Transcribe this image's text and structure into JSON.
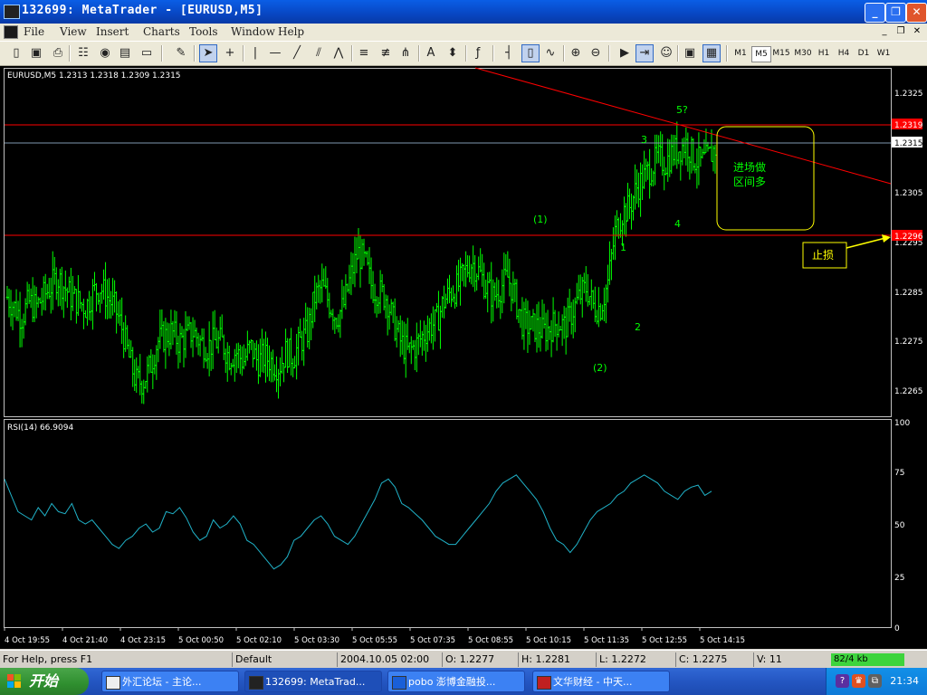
{
  "window": {
    "title": "132699: MetaTrader - [EURUSD,M5]",
    "controls": [
      "_",
      "❐",
      "✕"
    ]
  },
  "menu": {
    "items": [
      "File",
      "View",
      "Insert",
      "Charts",
      "Tools",
      "Window",
      "Help"
    ],
    "mdi_controls": [
      "_",
      "❐",
      "✕"
    ]
  },
  "toolbar": {
    "timeframes": [
      "M1",
      "M5",
      "M15",
      "M30",
      "H1",
      "H4",
      "D1",
      "W1"
    ],
    "selected_timeframe": "M5"
  },
  "chart": {
    "header": "EURUSD,M5  1.2313 1.2318 1.2309 1.2315",
    "price_ticks": [
      "1.2325",
      "1.2315",
      "1.2305",
      "1.2295",
      "1.2285",
      "1.2275",
      "1.2265"
    ],
    "levels": {
      "top_red": "1.2319",
      "bid": "1.2315",
      "stop_red": "1.2296"
    },
    "time_labels": [
      "4 Oct 19:55",
      "4 Oct 21:40",
      "4 Oct 23:15",
      "5 Oct 00:50",
      "5 Oct 02:10",
      "5 Oct 03:30",
      "5 Oct 05:55",
      "5 Oct 07:35",
      "5 Oct 08:55",
      "5 Oct 10:15",
      "5 Oct 11:35",
      "5 Oct 12:55",
      "5 Oct 14:15"
    ],
    "wave_labels": [
      "(1)",
      "(2)",
      "1",
      "2",
      "3",
      "4",
      "5?"
    ],
    "annotation_entry": "进场做\n区间多",
    "annotation_stop": "止损",
    "rsi_header": "RSI(14) 66.9094",
    "rsi_ticks": [
      "100",
      "75",
      "50",
      "25",
      "0"
    ],
    "colors": {
      "bar": "#00ff00",
      "rsi": "#20b2c8",
      "red_line": "#ff0000",
      "annotation": "#ffff00",
      "text_green": "#00ff00"
    }
  },
  "chart_data": {
    "type": "ohlc",
    "symbol": "EURUSD",
    "timeframe": "M5",
    "ylim": [
      1.2261,
      1.2331
    ],
    "rsi_ylim": [
      0,
      100
    ],
    "close_path": [
      1.2285,
      1.2283,
      1.2281,
      1.2284,
      1.2283,
      1.2285,
      1.2287,
      1.2289,
      1.2287,
      1.2285,
      1.2284,
      1.2283,
      1.2286,
      1.2287,
      1.2285,
      1.2283,
      1.2279,
      1.2273,
      1.2268,
      1.2268,
      1.2271,
      1.2276,
      1.2277,
      1.2278,
      1.2276,
      1.2277,
      1.2278,
      1.2276,
      1.2275,
      1.2276,
      1.2276,
      1.2273,
      1.2274,
      1.2272,
      1.2275,
      1.2272,
      1.2273,
      1.2272,
      1.2271,
      1.2274,
      1.2273,
      1.2276,
      1.2278,
      1.2285,
      1.2287,
      1.2284,
      1.2281,
      1.2283,
      1.2289,
      1.2294,
      1.2292,
      1.2287,
      1.2286,
      1.2285,
      1.228,
      1.2276,
      1.2274,
      1.2275,
      1.2277,
      1.2279,
      1.228,
      1.2284,
      1.2286,
      1.2287,
      1.229,
      1.2292,
      1.229,
      1.2287,
      1.2285,
      1.2287,
      1.2289,
      1.2285,
      1.228,
      1.2279,
      1.2279,
      1.2278,
      1.2279,
      1.228,
      1.2279,
      1.2282,
      1.2285,
      1.2287,
      1.2283,
      1.2283,
      1.2288,
      1.2298,
      1.2302,
      1.2303,
      1.2307,
      1.2309,
      1.2311,
      1.2313,
      1.2312,
      1.2314,
      1.2315,
      1.2316,
      1.2313,
      1.2312,
      1.2313,
      1.2315
    ],
    "rsi_path": [
      72,
      64,
      56,
      54,
      52,
      58,
      54,
      60,
      56,
      55,
      60,
      52,
      50,
      52,
      48,
      44,
      40,
      38,
      42,
      44,
      48,
      50,
      46,
      48,
      56,
      55,
      58,
      53,
      46,
      42,
      44,
      52,
      48,
      50,
      54,
      50,
      42,
      40,
      36,
      32,
      28,
      30,
      34,
      42,
      44,
      48,
      52,
      54,
      50,
      44,
      42,
      40,
      44,
      50,
      56,
      62,
      70,
      72,
      68,
      60,
      58,
      55,
      52,
      48,
      44,
      42,
      40,
      40,
      44,
      48,
      52,
      56,
      60,
      66,
      70,
      72,
      74,
      70,
      66,
      62,
      56,
      48,
      42,
      40,
      36,
      40,
      46,
      52,
      56,
      58,
      60,
      64,
      66,
      70,
      72,
      74,
      72,
      70,
      66,
      64,
      62,
      66,
      68,
      69,
      64,
      66
    ]
  },
  "status": {
    "help": "For Help, press F1",
    "profile": "Default",
    "datetime": "2004.10.05 02:00",
    "open": "O: 1.2277",
    "high": "H: 1.2281",
    "low": "L: 1.2272",
    "close": "C: 1.2275",
    "volume": "V: 11",
    "connection": "82/4 kb"
  },
  "taskbar": {
    "start": "开始",
    "tasks": [
      "外汇论坛 - 主论...",
      "132699: MetaTrad...",
      "pobo 澎博金融投...",
      "文华财经 - 中天..."
    ],
    "clock": "21:34"
  }
}
